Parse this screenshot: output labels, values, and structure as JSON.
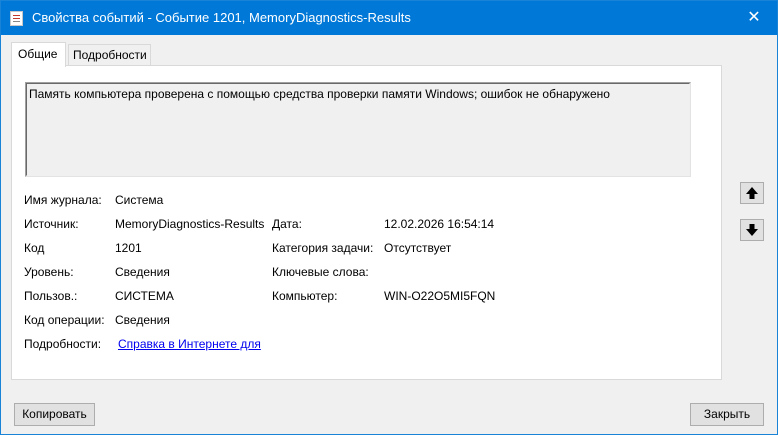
{
  "window": {
    "title": "Свойства событий - Событие 1201, MemoryDiagnostics-Results",
    "close_glyph": "✕"
  },
  "tabs": [
    {
      "label": "Общие",
      "active": true
    },
    {
      "label": "Подробности",
      "active": false
    }
  ],
  "description": "Память компьютера проверена с помощью средства проверки памяти Windows; ошибок не обнаружено",
  "fields": {
    "log_name": {
      "label": "Имя журнала:",
      "value": "Система"
    },
    "source": {
      "label": "Источник:",
      "value": "MemoryDiagnostics-Results"
    },
    "date": {
      "label": "Дата:",
      "value": "12.02.2026 16:54:14"
    },
    "event_id": {
      "label": "Код",
      "value": "1201"
    },
    "task_category": {
      "label": "Категория задачи:",
      "value": "Отсутствует"
    },
    "level": {
      "label": "Уровень:",
      "value": "Сведения"
    },
    "keywords": {
      "label": "Ключевые слова:",
      "value": ""
    },
    "user": {
      "label": "Пользов.:",
      "value": "СИСТЕМА"
    },
    "computer": {
      "label": "Компьютер:",
      "value": "WIN-O22O5MI5FQN"
    },
    "opcode": {
      "label": "Код операции:",
      "value": "Сведения"
    },
    "more_info": {
      "label": "Подробности:",
      "value": "Справка в Интернете для"
    }
  },
  "buttons": {
    "copy": "Копировать",
    "close": "Закрыть"
  },
  "colors": {
    "titlebar": "#0078d7",
    "link": "#0000ee"
  }
}
